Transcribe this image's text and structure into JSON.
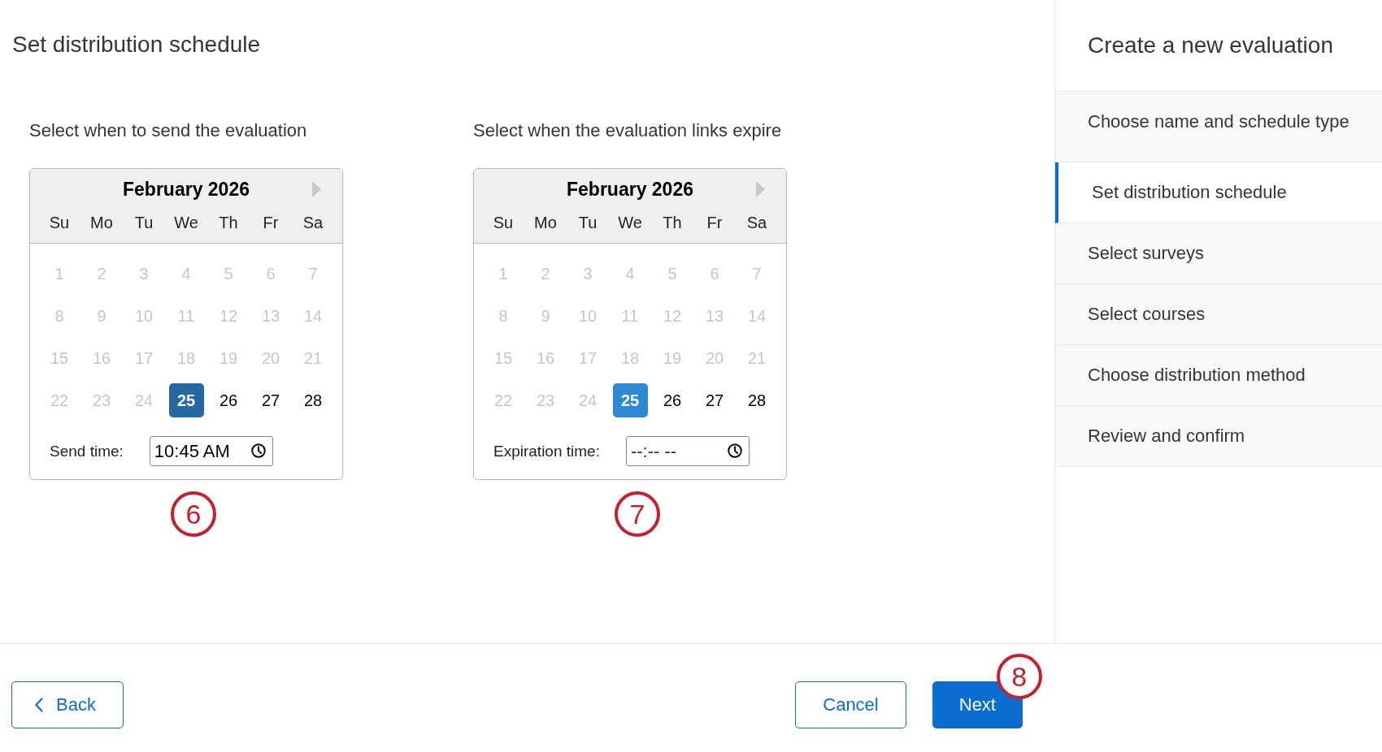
{
  "page_title": "Set distribution schedule",
  "schedules": [
    {
      "prompt": "Select when to send the evaluation",
      "calendar": {
        "month": "February 2026",
        "color": "#2468a4",
        "weekdays": [
          "Su",
          "Mo",
          "Tu",
          "We",
          "Th",
          "Fr",
          "Sa"
        ],
        "days": [
          {
            "label": "1",
            "disabled": true,
            "selected": false
          },
          {
            "label": "2",
            "disabled": true,
            "selected": false
          },
          {
            "label": "3",
            "disabled": true,
            "selected": false
          },
          {
            "label": "4",
            "disabled": true,
            "selected": false
          },
          {
            "label": "5",
            "disabled": true,
            "selected": false
          },
          {
            "label": "6",
            "disabled": true,
            "selected": false
          },
          {
            "label": "7",
            "disabled": true,
            "selected": false
          },
          {
            "label": "8",
            "disabled": true,
            "selected": false
          },
          {
            "label": "9",
            "disabled": true,
            "selected": false
          },
          {
            "label": "10",
            "disabled": true,
            "selected": false
          },
          {
            "label": "11",
            "disabled": true,
            "selected": false
          },
          {
            "label": "12",
            "disabled": true,
            "selected": false
          },
          {
            "label": "13",
            "disabled": true,
            "selected": false
          },
          {
            "label": "14",
            "disabled": true,
            "selected": false
          },
          {
            "label": "15",
            "disabled": true,
            "selected": false
          },
          {
            "label": "16",
            "disabled": true,
            "selected": false
          },
          {
            "label": "17",
            "disabled": true,
            "selected": false
          },
          {
            "label": "18",
            "disabled": true,
            "selected": false
          },
          {
            "label": "19",
            "disabled": true,
            "selected": false
          },
          {
            "label": "20",
            "disabled": true,
            "selected": false
          },
          {
            "label": "21",
            "disabled": true,
            "selected": false
          },
          {
            "label": "22",
            "disabled": true,
            "selected": false
          },
          {
            "label": "23",
            "disabled": true,
            "selected": false
          },
          {
            "label": "24",
            "disabled": true,
            "selected": false
          },
          {
            "label": "25",
            "disabled": false,
            "selected": true
          },
          {
            "label": "26",
            "disabled": false,
            "selected": false
          },
          {
            "label": "27",
            "disabled": false,
            "selected": false
          },
          {
            "label": "28",
            "disabled": false,
            "selected": false
          }
        ]
      },
      "time": {
        "label": "Send time:",
        "value": "10:45 AM"
      },
      "callout": "6"
    },
    {
      "prompt": "Select when the evaluation links expire",
      "calendar": {
        "month": "February 2026",
        "color": "#2e89d5",
        "weekdays": [
          "Su",
          "Mo",
          "Tu",
          "We",
          "Th",
          "Fr",
          "Sa"
        ],
        "days": [
          {
            "label": "1",
            "disabled": true,
            "selected": false
          },
          {
            "label": "2",
            "disabled": true,
            "selected": false
          },
          {
            "label": "3",
            "disabled": true,
            "selected": false
          },
          {
            "label": "4",
            "disabled": true,
            "selected": false
          },
          {
            "label": "5",
            "disabled": true,
            "selected": false
          },
          {
            "label": "6",
            "disabled": true,
            "selected": false
          },
          {
            "label": "7",
            "disabled": true,
            "selected": false
          },
          {
            "label": "8",
            "disabled": true,
            "selected": false
          },
          {
            "label": "9",
            "disabled": true,
            "selected": false
          },
          {
            "label": "10",
            "disabled": true,
            "selected": false
          },
          {
            "label": "11",
            "disabled": true,
            "selected": false
          },
          {
            "label": "12",
            "disabled": true,
            "selected": false
          },
          {
            "label": "13",
            "disabled": true,
            "selected": false
          },
          {
            "label": "14",
            "disabled": true,
            "selected": false
          },
          {
            "label": "15",
            "disabled": true,
            "selected": false
          },
          {
            "label": "16",
            "disabled": true,
            "selected": false
          },
          {
            "label": "17",
            "disabled": true,
            "selected": false
          },
          {
            "label": "18",
            "disabled": true,
            "selected": false
          },
          {
            "label": "19",
            "disabled": true,
            "selected": false
          },
          {
            "label": "20",
            "disabled": true,
            "selected": false
          },
          {
            "label": "21",
            "disabled": true,
            "selected": false
          },
          {
            "label": "22",
            "disabled": true,
            "selected": false
          },
          {
            "label": "23",
            "disabled": true,
            "selected": false
          },
          {
            "label": "24",
            "disabled": true,
            "selected": false
          },
          {
            "label": "25",
            "disabled": false,
            "selected": true
          },
          {
            "label": "26",
            "disabled": false,
            "selected": false
          },
          {
            "label": "27",
            "disabled": false,
            "selected": false
          },
          {
            "label": "28",
            "disabled": false,
            "selected": false
          }
        ]
      },
      "time": {
        "label": "Expiration time:",
        "placeholder": "--:-- --"
      },
      "callout": "7"
    }
  ],
  "sidebar": {
    "title": "Create a new evaluation",
    "steps": [
      {
        "label": "Choose name and schedule type",
        "selected": false
      },
      {
        "label": "Set distribution schedule",
        "selected": true
      },
      {
        "label": "Select surveys",
        "selected": false
      },
      {
        "label": "Select courses",
        "selected": false
      },
      {
        "label": "Choose distribution method",
        "selected": false
      },
      {
        "label": "Review and confirm",
        "selected": false
      }
    ]
  },
  "footer": {
    "buttons": [
      {
        "label": "Back",
        "kind": "back"
      },
      {
        "label": "Cancel",
        "kind": "secondary"
      },
      {
        "label": "Next",
        "kind": "primary",
        "callout": "8"
      }
    ]
  }
}
